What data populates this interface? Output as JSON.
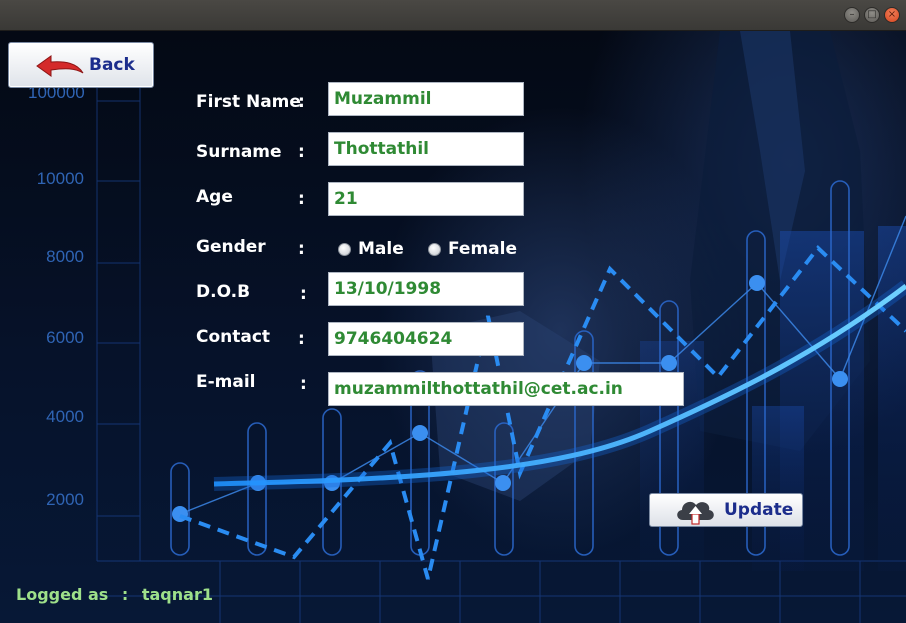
{
  "window": {
    "controls": [
      "minimize-icon",
      "maximize-icon",
      "close-icon"
    ],
    "close_color": "#e0532a"
  },
  "background": {
    "y_ticks": [
      "100000",
      "10000",
      "8000",
      "6000",
      "4000",
      "2000"
    ]
  },
  "back_button": {
    "label": "Back",
    "icon": "back-arrow-icon",
    "icon_color": "#d42a2a"
  },
  "form": {
    "separator": ":",
    "first_name": {
      "label": "First Name",
      "value": "Muzammil"
    },
    "surname": {
      "label": "Surname",
      "value": "Thottathil"
    },
    "age": {
      "label": "Age",
      "value": "21"
    },
    "gender": {
      "label": "Gender",
      "options": [
        "Male",
        "Female"
      ],
      "selected": null
    },
    "dob": {
      "label": "D.O.B",
      "value": "13/10/1998"
    },
    "contact": {
      "label": "Contact",
      "value": "9746404624"
    },
    "email": {
      "label": "E-mail",
      "value": "muzammilthottathil@cet.ac.in"
    }
  },
  "update_button": {
    "label": "Update",
    "icon": "cloud-upload-icon"
  },
  "status": {
    "logged_label": "Logged as",
    "separator": ":",
    "username": "taqnar1"
  },
  "colors": {
    "value_text": "#2f8a34",
    "button_text": "#1c2d8c",
    "status_text": "#9ee08a",
    "chart_accent": "#1e90ff"
  }
}
